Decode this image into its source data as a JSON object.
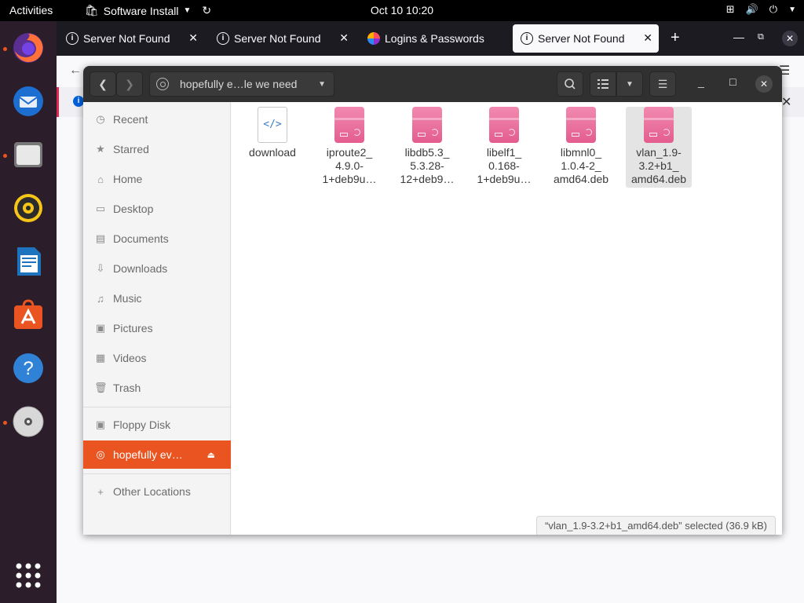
{
  "topbar": {
    "activities": "Activities",
    "app_menu": "Software Install",
    "clock": "Oct 10  10:20"
  },
  "dock": {
    "items": [
      {
        "name": "firefox-icon",
        "running": true
      },
      {
        "name": "thunderbird-icon",
        "running": false
      },
      {
        "name": "files-icon",
        "running": true
      },
      {
        "name": "rhythmbox-icon",
        "running": false
      },
      {
        "name": "libreoffice-writer-icon",
        "running": false
      },
      {
        "name": "ubuntu-software-icon",
        "running": false
      },
      {
        "name": "help-icon",
        "running": false
      },
      {
        "name": "cd-drive-icon",
        "running": true
      },
      {
        "name": "show-apps-icon",
        "running": false
      }
    ]
  },
  "firefox": {
    "tabs": [
      {
        "label": "Server Not Found",
        "active": false,
        "icon": "info-icon"
      },
      {
        "label": "Server Not Found",
        "active": false,
        "icon": "info-icon"
      },
      {
        "label": "Logins & Passwords",
        "active": false,
        "icon": "lockwise-icon"
      },
      {
        "label": "Server Not Found",
        "active": true,
        "icon": "info-icon"
      }
    ]
  },
  "files_window": {
    "path_label": "hopefully e…le we need",
    "sidebar": {
      "places": [
        {
          "label": "Recent",
          "icon": "clock-icon"
        },
        {
          "label": "Starred",
          "icon": "star-icon"
        },
        {
          "label": "Home",
          "icon": "home-icon"
        },
        {
          "label": "Desktop",
          "icon": "desktop-icon"
        },
        {
          "label": "Documents",
          "icon": "documents-icon"
        },
        {
          "label": "Downloads",
          "icon": "downloads-icon"
        },
        {
          "label": "Music",
          "icon": "music-icon"
        },
        {
          "label": "Pictures",
          "icon": "pictures-icon"
        },
        {
          "label": "Videos",
          "icon": "videos-icon"
        },
        {
          "label": "Trash",
          "icon": "trash-icon"
        }
      ],
      "devices": [
        {
          "label": "Floppy Disk",
          "icon": "floppy-icon",
          "active": false
        },
        {
          "label": "hopefully ev…",
          "icon": "disc-icon",
          "active": true
        }
      ],
      "other": {
        "label": "Other Locations",
        "icon": "plus-icon"
      }
    },
    "files": [
      {
        "name_lines": [
          "download"
        ],
        "type": "code",
        "selected": false
      },
      {
        "name_lines": [
          "iproute2_",
          "4.9.0-",
          "1+deb9u…"
        ],
        "type": "deb",
        "selected": false
      },
      {
        "name_lines": [
          "libdb5.3_",
          "5.3.28-",
          "12+deb9…"
        ],
        "type": "deb",
        "selected": false
      },
      {
        "name_lines": [
          "libelf1_",
          "0.168-",
          "1+deb9u…"
        ],
        "type": "deb",
        "selected": false
      },
      {
        "name_lines": [
          "libmnl0_",
          "1.0.4-2_",
          "amd64.deb"
        ],
        "type": "deb",
        "selected": false
      },
      {
        "name_lines": [
          "vlan_1.9-",
          "3.2+b1_",
          "amd64.deb"
        ],
        "type": "deb",
        "selected": true
      }
    ],
    "status": "“vlan_1.9-3.2+b1_amd64.deb” selected  (36.9 kB)"
  }
}
